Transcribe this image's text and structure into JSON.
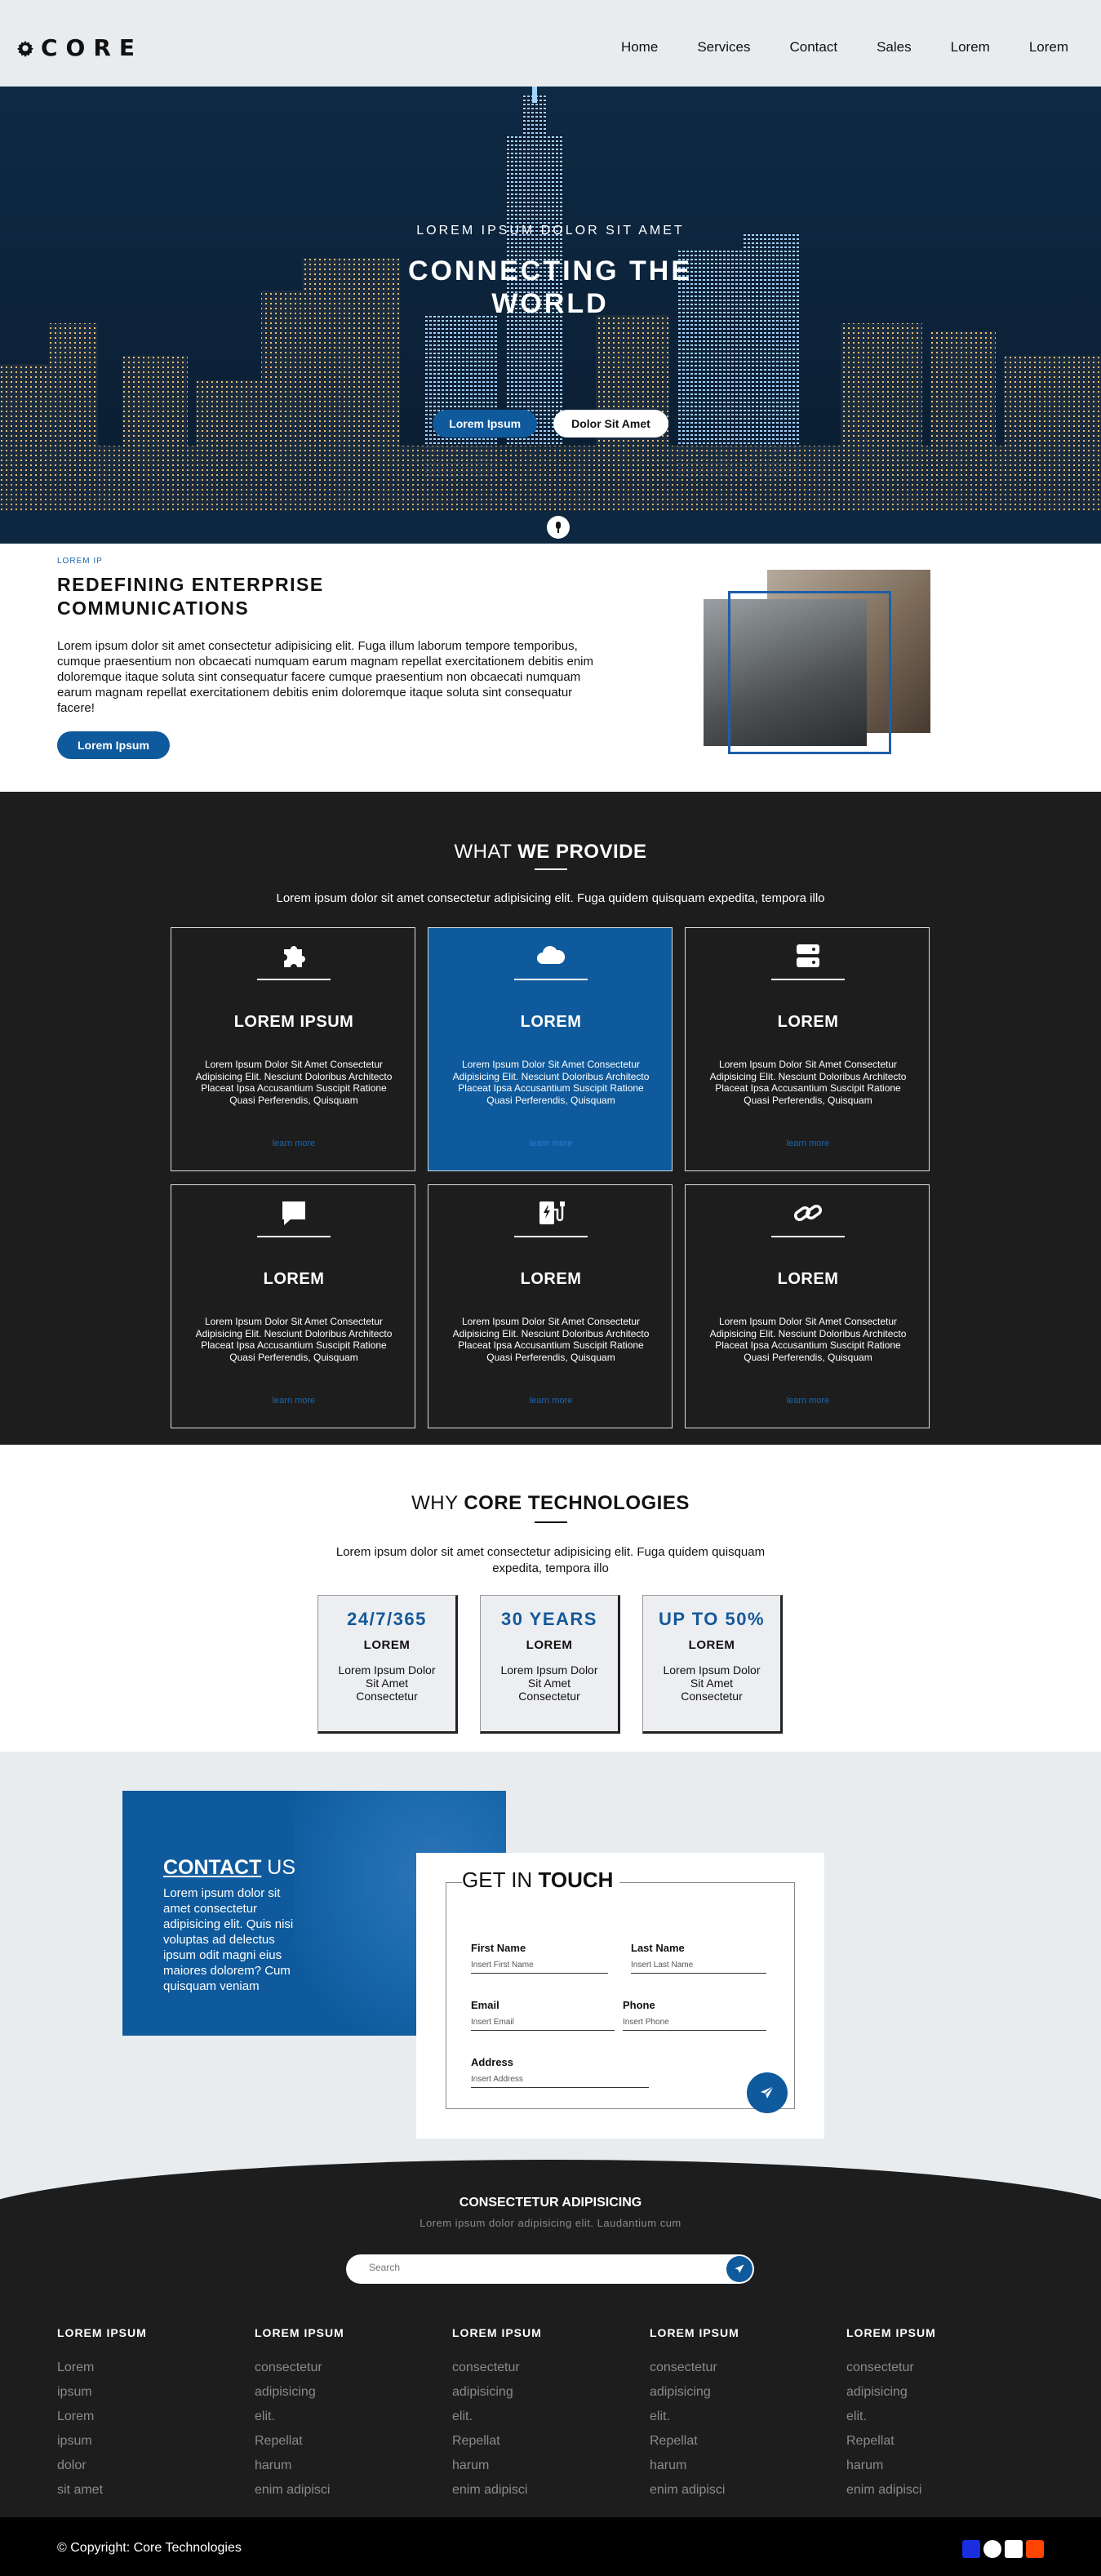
{
  "header": {
    "brand": "CORE",
    "nav": [
      "Home",
      "Services",
      "Contact",
      "Sales",
      "Lorem",
      "Lorem"
    ]
  },
  "hero": {
    "kicker": "LOREM IPSUM DOLOR SIT AMET",
    "title": "CONNECTING THE WORLD",
    "primary_button": "Lorem Ipsum",
    "secondary_button": "Dolor Sit Amet"
  },
  "intro": {
    "kicker": "LOREM IP",
    "title": "REDEFINING ENTERPRISE COMMUNICATIONS",
    "body": "Lorem ipsum dolor sit amet consectetur adipisicing elit. Fuga illum laborum tempore temporibus, cumque praesentium non obcaecati numquam earum magnam repellat exercitationem debitis enim doloremque itaque soluta sint consequatur facere cumque praesentium non obcaecati numquam earum magnam repellat exercitationem debitis enim doloremque itaque soluta sint consequatur facere!",
    "button": "Lorem Ipsum"
  },
  "provide": {
    "title_light": "WHAT ",
    "title_bold": "WE PROVIDE",
    "subtitle": "Lorem ipsum dolor sit amet consectetur adipisicing elit. Fuga quidem quisquam expedita, tempora illo",
    "cards": [
      {
        "icon": "puzzle-icon",
        "title": "LOREM IPSUM",
        "text": "Lorem Ipsum Dolor Sit Amet Consectetur Adipisicing Elit. Nesciunt Doloribus Architecto Placeat Ipsa Accusantium Suscipit Ratione Quasi Perferendis, Quisquam",
        "link": "learn more"
      },
      {
        "icon": "cloud-icon",
        "title": "LOREM",
        "text": "Lorem Ipsum Dolor Sit Amet Consectetur Adipisicing Elit. Nesciunt Doloribus Architecto Placeat Ipsa Accusantium Suscipit Ratione Quasi Perferendis, Quisquam",
        "link": "learn more"
      },
      {
        "icon": "server-icon",
        "title": "LOREM",
        "text": "Lorem Ipsum Dolor Sit Amet Consectetur Adipisicing Elit. Nesciunt Doloribus Architecto Placeat Ipsa Accusantium Suscipit Ratione Quasi Perferendis, Quisquam",
        "link": "learn more"
      },
      {
        "icon": "chat-icon",
        "title": "LOREM",
        "text": "Lorem Ipsum Dolor Sit Amet Consectetur Adipisicing Elit. Nesciunt Doloribus Architecto Placeat Ipsa Accusantium Suscipit Ratione Quasi Perferendis, Quisquam",
        "link": "learn more"
      },
      {
        "icon": "charging-station-icon",
        "title": "LOREM",
        "text": "Lorem Ipsum Dolor Sit Amet Consectetur Adipisicing Elit. Nesciunt Doloribus Architecto Placeat Ipsa Accusantium Suscipit Ratione Quasi Perferendis, Quisquam",
        "link": "learn more"
      },
      {
        "icon": "link-icon",
        "title": "LOREM",
        "text": "Lorem Ipsum Dolor Sit Amet Consectetur Adipisicing Elit. Nesciunt Doloribus Architecto Placeat Ipsa Accusantium Suscipit Ratione Quasi Perferendis, Quisquam",
        "link": "learn more"
      }
    ]
  },
  "why": {
    "title_light": "WHY ",
    "title_bold": "CORE TECHNOLOGIES",
    "subtitle": "Lorem ipsum dolor sit amet consectetur adipisicing elit. Fuga quidem quisquam expedita, tempora illo",
    "stats": [
      {
        "value": "24/7/365",
        "label": "LOREM",
        "text": "Lorem Ipsum Dolor Sit Amet Consectetur"
      },
      {
        "value": "30 YEARS",
        "label": "LOREM",
        "text": "Lorem Ipsum Dolor Sit Amet Consectetur"
      },
      {
        "value": "UP TO 50%",
        "label": "LOREM",
        "text": "Lorem Ipsum Dolor Sit Amet Consectetur"
      }
    ]
  },
  "contact": {
    "title_bold": "CONTACT",
    "title_light": " US",
    "body": "Lorem ipsum dolor sit amet consectetur adipisicing elit. Quis nisi voluptas ad delectus ipsum odit magni eius maiores dolorem? Cum quisquam veniam"
  },
  "form": {
    "title_light": "GET IN ",
    "title_bold": "TOUCH",
    "first_name_label": "First Name",
    "first_name_placeholder": "Insert First Name",
    "last_name_label": "Last Name",
    "last_name_placeholder": "Insert Last Name",
    "email_label": "Email",
    "email_placeholder": "Insert Email",
    "phone_label": "Phone",
    "phone_placeholder": "Insert Phone",
    "address_label": "Address",
    "address_placeholder": "Insert Address"
  },
  "footer": {
    "title": "CONSECTETUR ADIPISICING",
    "subtitle": "Lorem ipsum dolor adipisicing elit. Laudantium cum",
    "search_placeholder": "Search",
    "columns": [
      {
        "title": "LOREM IPSUM",
        "items": [
          "Lorem",
          "ipsum",
          "Lorem",
          "ipsum",
          "dolor",
          "sit amet"
        ]
      },
      {
        "title": "LOREM IPSUM",
        "items": [
          "consectetur",
          "adipisicing",
          "elit.",
          "Repellat",
          "harum",
          "enim adipisci"
        ]
      },
      {
        "title": "LOREM IPSUM",
        "items": [
          "consectetur",
          "adipisicing",
          "elit.",
          "Repellat",
          "harum",
          "enim adipisci"
        ]
      },
      {
        "title": "LOREM IPSUM",
        "items": [
          "consectetur",
          "adipisicing",
          "elit.",
          "Repellat",
          "harum",
          "enim adipisci"
        ]
      },
      {
        "title": "LOREM IPSUM",
        "items": [
          "consectetur",
          "adipisicing",
          "elit.",
          "Repellat",
          "harum",
          "enim adipisci"
        ]
      }
    ],
    "copyright": "© Copyright: Core Technologies",
    "social": [
      {
        "icon": "facebook-icon",
        "color": "#1a2ee0"
      },
      {
        "icon": "telegram-icon",
        "color": "#ffffff"
      },
      {
        "icon": "github-icon",
        "color": "#ffffff"
      },
      {
        "icon": "reddit-icon",
        "color": "#ff4500"
      }
    ]
  },
  "colors": {
    "accent": "#0f5a9c",
    "dark": "#1d1d1d",
    "light": "#e9ecef"
  }
}
